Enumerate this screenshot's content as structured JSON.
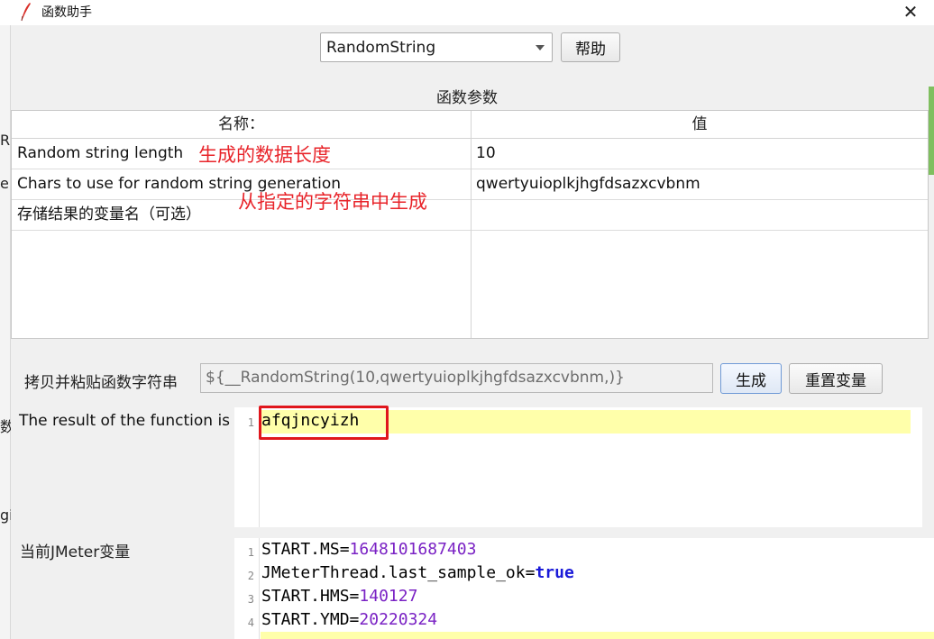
{
  "window": {
    "title": "函数助手",
    "close_glyph": "✕"
  },
  "controls": {
    "function_select": "RandomString",
    "help_button": "帮助"
  },
  "params": {
    "section_label": "函数参数",
    "columns": [
      "名称：",
      "值"
    ],
    "rows": [
      {
        "name": "Random string length",
        "value": "10"
      },
      {
        "name": "Chars to use for random string generation",
        "value": "qwertyuioplkjhgfdsazxcvbnm"
      },
      {
        "name": "存储结果的变量名（可选）",
        "value": ""
      }
    ]
  },
  "annotations": {
    "length_note": "生成的数据长度",
    "chars_note": "从指定的字符串中生成"
  },
  "copy": {
    "label": "拷贝并粘贴函数字符串",
    "value": "${__RandomString(10,qwertyuioplkjhgfdsazxcvbnm,)}",
    "generate_button": "生成",
    "reset_button": "重置变量"
  },
  "result": {
    "label": "The result of the function is",
    "lines": [
      {
        "n": "1",
        "text": "afqjncyizh"
      }
    ]
  },
  "vars": {
    "label": "当前JMeter变量",
    "lines": [
      {
        "n": "1",
        "key": "START.MS",
        "value": "1648101687403"
      },
      {
        "n": "2",
        "key": "JMeterThread.last_sample_ok",
        "value": "true"
      },
      {
        "n": "3",
        "key": "START.HMS",
        "value": "140127"
      },
      {
        "n": "4",
        "key": "START.YMD",
        "value": "20220324"
      }
    ]
  },
  "background": {
    "fragments": [
      "R",
      "e",
      "数",
      "gi"
    ]
  },
  "colors": {
    "annotation": "#e8242a",
    "highlight": "#ffffaa",
    "number": "#7a22c4",
    "keyword": "#1a1ad8"
  }
}
